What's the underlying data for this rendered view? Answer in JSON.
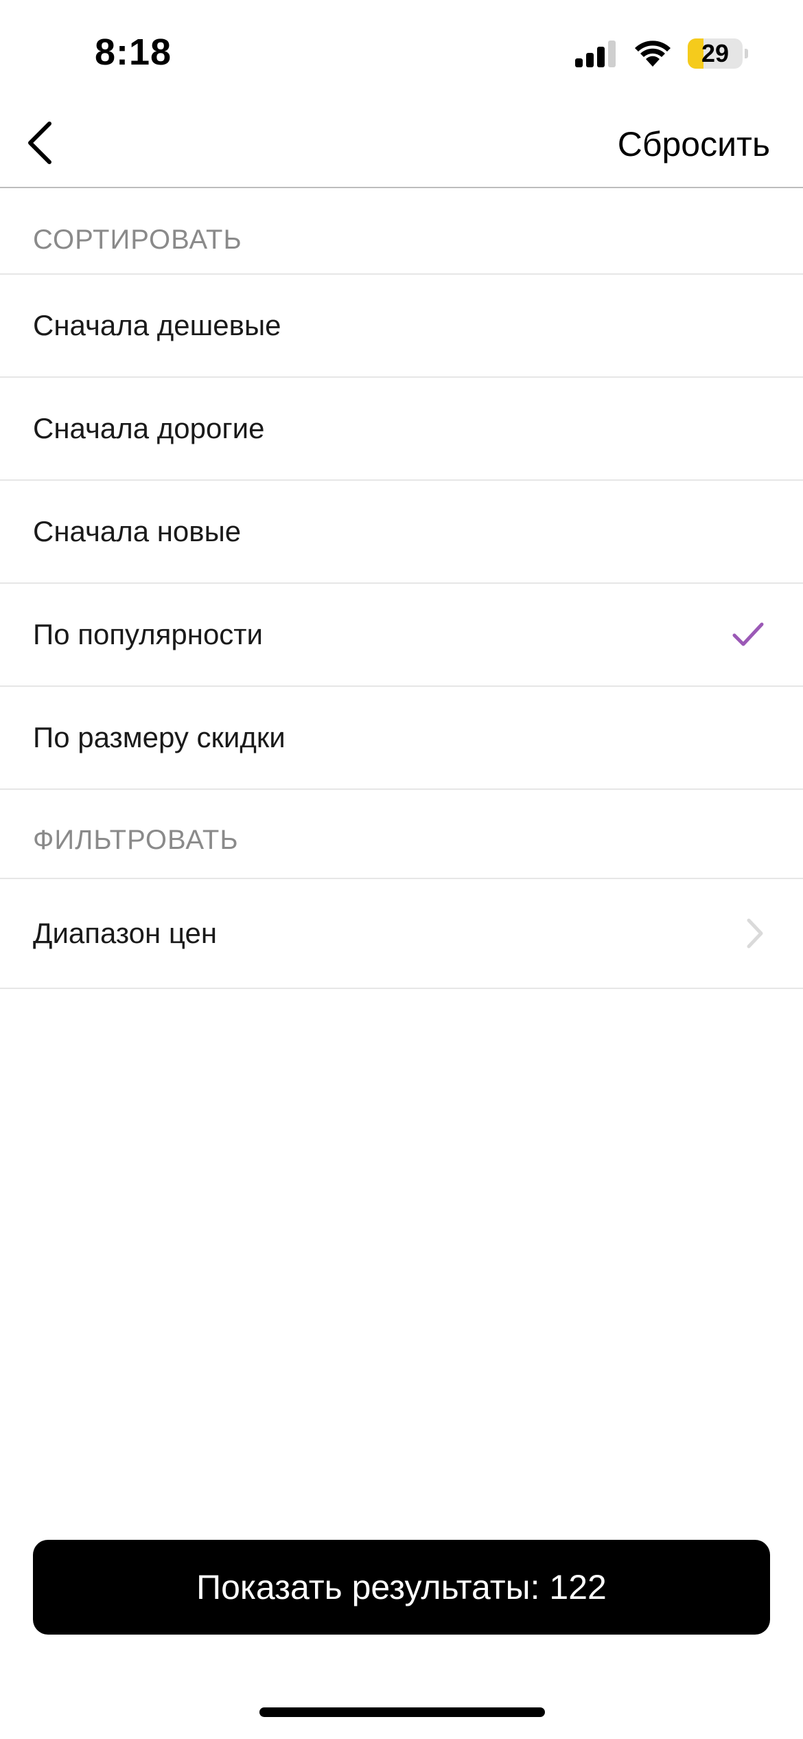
{
  "status_bar": {
    "time": "8:18",
    "battery_percent": "29",
    "battery_level": 0.29,
    "battery_color": "#f5cb1c"
  },
  "nav": {
    "back_icon": "chevron-left-icon",
    "reset_label": "Сбросить"
  },
  "sort_section": {
    "header": "СОРТИРОВАТЬ",
    "options": [
      {
        "label": "Сначала дешевые",
        "selected": false
      },
      {
        "label": "Сначала дорогие",
        "selected": false
      },
      {
        "label": "Сначала новые",
        "selected": false
      },
      {
        "label": "По популярности",
        "selected": true
      },
      {
        "label": "По размеру скидки",
        "selected": false
      }
    ],
    "check_icon": "checkmark-icon",
    "check_color": "#9b59b6"
  },
  "filter_section": {
    "header": "ФИЛЬТРОВАТЬ",
    "items": [
      {
        "label": "Диапазон цен",
        "icon": "chevron-right-icon"
      }
    ]
  },
  "results_button": {
    "label": "Показать результаты: 122"
  },
  "colors": {
    "section_header": "#8a8a8a",
    "divider": "#e6e6e6",
    "button_bg": "#000000",
    "button_text": "#ffffff"
  }
}
